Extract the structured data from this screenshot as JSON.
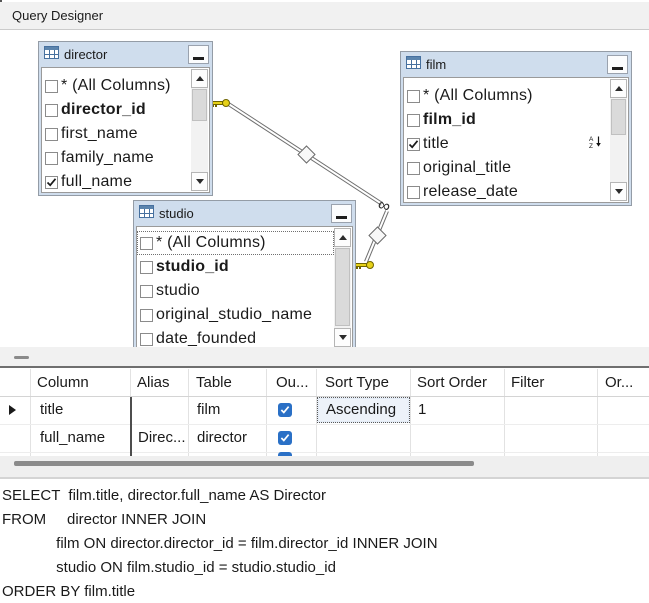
{
  "titlebar": {
    "title": "Query Designer"
  },
  "colors": {
    "table_header": "#cfdded",
    "output_checkbox": "#2a70c6",
    "key_icon": "#e6d118"
  },
  "diagram": {
    "tables": [
      {
        "name": "director",
        "columns": [
          {
            "label": "* (All Columns)",
            "checked": false
          },
          {
            "label": "director_id",
            "checked": false,
            "bold": true
          },
          {
            "label": "first_name",
            "checked": false
          },
          {
            "label": "family_name",
            "checked": false
          },
          {
            "label": "full_name",
            "checked": true
          }
        ]
      },
      {
        "name": "film",
        "columns": [
          {
            "label": "* (All Columns)",
            "checked": false
          },
          {
            "label": "film_id",
            "checked": false,
            "bold": true
          },
          {
            "label": "title",
            "checked": true,
            "sorted": "ascending"
          },
          {
            "label": "original_title",
            "checked": false
          },
          {
            "label": "release_date",
            "checked": false
          }
        ]
      },
      {
        "name": "studio",
        "columns": [
          {
            "label": "* (All Columns)",
            "checked": false
          },
          {
            "label": "studio_id",
            "checked": false,
            "bold": true
          },
          {
            "label": "studio",
            "checked": false
          },
          {
            "label": "original_studio_name",
            "checked": false
          },
          {
            "label": "date_founded",
            "checked": false
          }
        ]
      }
    ],
    "joins": [
      {
        "from": "director",
        "to": "film",
        "type": "inner"
      },
      {
        "from": "film",
        "to": "studio",
        "type": "inner"
      }
    ]
  },
  "grid": {
    "headers": [
      "Column",
      "Alias",
      "Table",
      "Ou...",
      "Sort Type",
      "Sort Order",
      "Filter",
      "Or..."
    ],
    "rows": [
      {
        "column": "title",
        "alias": "",
        "table": "film",
        "output": true,
        "sort_type": "Ascending",
        "sort_order": "1"
      },
      {
        "column": "full_name",
        "alias": "Direc...",
        "table": "director",
        "output": true,
        "sort_type": "",
        "sort_order": ""
      }
    ]
  },
  "sql": {
    "lines": [
      "SELECT  film.title, director.full_name AS Director",
      "FROM     director INNER JOIN",
      "             film ON director.director_id = film.director_id INNER JOIN",
      "             studio ON film.studio_id = studio.studio_id",
      "ORDER BY film.title"
    ]
  }
}
